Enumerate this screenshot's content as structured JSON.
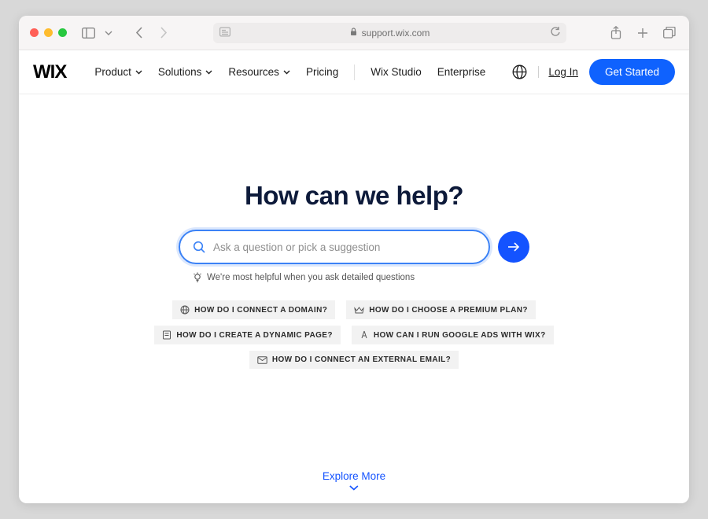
{
  "browser": {
    "url_host": "support.wix.com"
  },
  "header": {
    "logo": "WIX",
    "nav": {
      "product": "Product",
      "solutions": "Solutions",
      "resources": "Resources",
      "pricing": "Pricing",
      "wix_studio": "Wix Studio",
      "enterprise": "Enterprise"
    },
    "login": "Log In",
    "get_started": "Get Started"
  },
  "main": {
    "headline": "How can we help?",
    "search_placeholder": "Ask a question or pick a suggestion",
    "hint": "We're most helpful when you ask detailed questions",
    "suggestions": [
      "HOW DO I CONNECT A DOMAIN?",
      "HOW DO I CHOOSE A PREMIUM PLAN?",
      "HOW DO I CREATE A DYNAMIC PAGE?",
      "HOW CAN I RUN GOOGLE ADS WITH WIX?",
      "HOW DO I CONNECT AN EXTERNAL EMAIL?"
    ],
    "explore": "Explore More"
  }
}
